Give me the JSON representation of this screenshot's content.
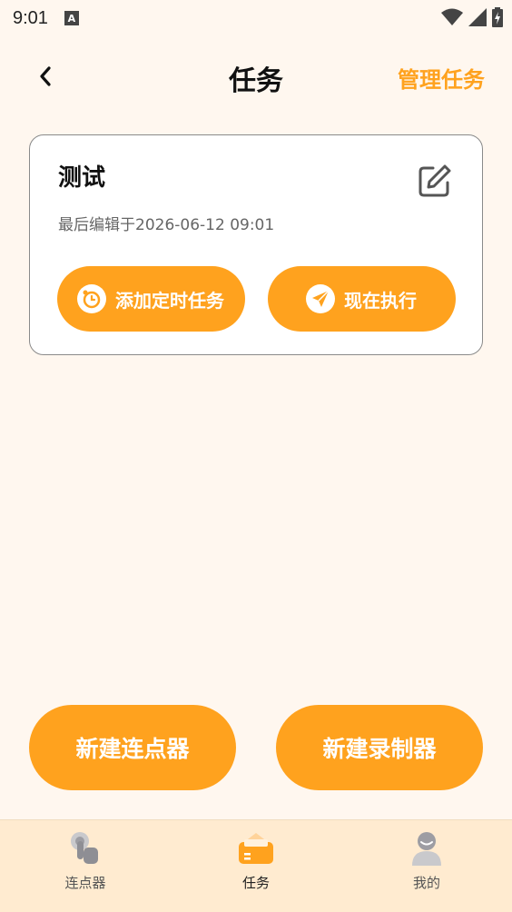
{
  "status_bar": {
    "time": "9:01",
    "notification_letter": "A"
  },
  "header": {
    "title": "任务",
    "manage_label": "管理任务"
  },
  "task": {
    "name": "测试",
    "last_edited": "最后编辑于2026-06-12 09:01",
    "schedule_label": "添加定时任务",
    "run_label": "现在执行"
  },
  "actions": {
    "new_clicker": "新建连点器",
    "new_recorder": "新建录制器"
  },
  "nav": {
    "items": [
      {
        "label": "连点器",
        "icon": "tap-hand-icon"
      },
      {
        "label": "任务",
        "icon": "task-folder-icon"
      },
      {
        "label": "我的",
        "icon": "profile-icon"
      }
    ],
    "active_index": 1
  },
  "colors": {
    "accent": "#FFA21E",
    "background": "#FFF7EF",
    "nav_bg": "#FFEBD0"
  }
}
